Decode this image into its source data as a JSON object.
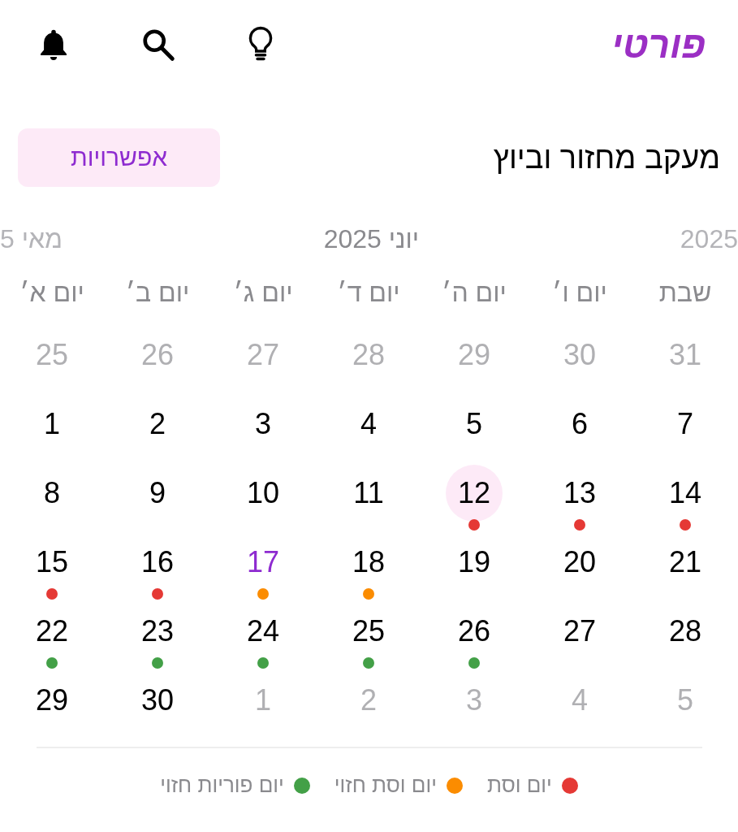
{
  "header": {
    "logo": "פורטי"
  },
  "title": "מעקב מחזור וביוץ",
  "options_button": "אפשרויות",
  "calendar": {
    "month": "יוני 2025",
    "prev_month": "מאי 5",
    "next_month": "2025",
    "weekdays": [
      "שבת",
      "יום ו׳",
      "יום ה׳",
      "יום ד׳",
      "יום ג׳",
      "יום ב׳",
      "יום א׳"
    ],
    "days": [
      {
        "label": "31",
        "muted": true,
        "selected": false,
        "today": false
      },
      {
        "label": "30",
        "muted": true,
        "selected": false,
        "today": false
      },
      {
        "label": "29",
        "muted": true,
        "selected": false,
        "today": false
      },
      {
        "label": "28",
        "muted": true,
        "selected": false,
        "today": false
      },
      {
        "label": "27",
        "muted": true,
        "selected": false,
        "today": false
      },
      {
        "label": "26",
        "muted": true,
        "selected": false,
        "today": false
      },
      {
        "label": "25",
        "muted": true,
        "selected": false,
        "today": false
      },
      {
        "label": "7",
        "muted": false,
        "selected": false,
        "today": false
      },
      {
        "label": "6",
        "muted": false,
        "selected": false,
        "today": false
      },
      {
        "label": "5",
        "muted": false,
        "selected": false,
        "today": false
      },
      {
        "label": "4",
        "muted": false,
        "selected": false,
        "today": false
      },
      {
        "label": "3",
        "muted": false,
        "selected": false,
        "today": false
      },
      {
        "label": "2",
        "muted": false,
        "selected": false,
        "today": false
      },
      {
        "label": "1",
        "muted": false,
        "selected": false,
        "today": false
      },
      {
        "label": "14",
        "muted": false,
        "selected": false,
        "today": false,
        "color": "#e53935"
      },
      {
        "label": "13",
        "muted": false,
        "selected": false,
        "today": false,
        "color": "#e53935"
      },
      {
        "label": "12",
        "muted": false,
        "selected": true,
        "today": false,
        "color": "#e53935"
      },
      {
        "label": "11",
        "muted": false,
        "selected": false,
        "today": false
      },
      {
        "label": "10",
        "muted": false,
        "selected": false,
        "today": false
      },
      {
        "label": "9",
        "muted": false,
        "selected": false,
        "today": false
      },
      {
        "label": "8",
        "muted": false,
        "selected": false,
        "today": false
      },
      {
        "label": "21",
        "muted": false,
        "selected": false,
        "today": false
      },
      {
        "label": "20",
        "muted": false,
        "selected": false,
        "today": false
      },
      {
        "label": "19",
        "muted": false,
        "selected": false,
        "today": false
      },
      {
        "label": "18",
        "muted": false,
        "selected": false,
        "today": false,
        "color": "#fb8c00"
      },
      {
        "label": "17",
        "muted": false,
        "selected": false,
        "today": true,
        "color": "#fb8c00"
      },
      {
        "label": "16",
        "muted": false,
        "selected": false,
        "today": false,
        "color": "#e53935"
      },
      {
        "label": "15",
        "muted": false,
        "selected": false,
        "today": false,
        "color": "#e53935"
      },
      {
        "label": "28",
        "muted": false,
        "selected": false,
        "today": false
      },
      {
        "label": "27",
        "muted": false,
        "selected": false,
        "today": false
      },
      {
        "label": "26",
        "muted": false,
        "selected": false,
        "today": false,
        "color": "#43a047"
      },
      {
        "label": "25",
        "muted": false,
        "selected": false,
        "today": false,
        "color": "#43a047"
      },
      {
        "label": "24",
        "muted": false,
        "selected": false,
        "today": false,
        "color": "#43a047"
      },
      {
        "label": "23",
        "muted": false,
        "selected": false,
        "today": false,
        "color": "#43a047"
      },
      {
        "label": "22",
        "muted": false,
        "selected": false,
        "today": false,
        "color": "#43a047"
      },
      {
        "label": "5",
        "muted": true,
        "selected": false,
        "today": false
      },
      {
        "label": "4",
        "muted": true,
        "selected": false,
        "today": false
      },
      {
        "label": "3",
        "muted": true,
        "selected": false,
        "today": false
      },
      {
        "label": "2",
        "muted": true,
        "selected": false,
        "today": false
      },
      {
        "label": "1",
        "muted": true,
        "selected": false,
        "today": false
      },
      {
        "label": "30",
        "muted": false,
        "selected": false,
        "today": false
      },
      {
        "label": "29",
        "muted": false,
        "selected": false,
        "today": false
      }
    ]
  },
  "legend": [
    {
      "label": "יום וסת",
      "color": "#e53935"
    },
    {
      "label": "יום וסת חזוי",
      "color": "#fb8c00"
    },
    {
      "label": "יום פוריות חזוי",
      "color": "#43a047"
    }
  ]
}
